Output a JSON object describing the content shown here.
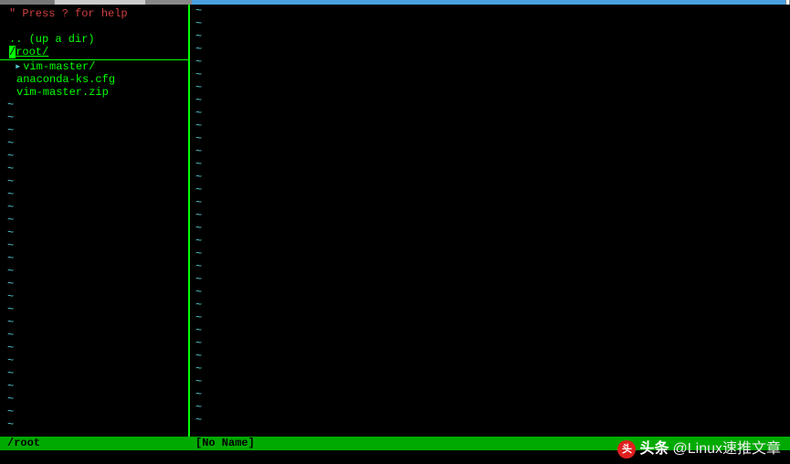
{
  "nerdtree": {
    "help_quote": "\"",
    "help_text": " Press ? for help",
    "updir": ".. (up a dir)",
    "root_first": "/",
    "root_rest": "root/",
    "items": [
      {
        "arrow": "▸",
        "name": "vim-master/",
        "type": "dir"
      },
      {
        "arrow": " ",
        "name": "anaconda-ks.cfg",
        "type": "file"
      },
      {
        "arrow": " ",
        "name": "vim-master.zip",
        "type": "file"
      }
    ],
    "tilde": "~"
  },
  "editor": {
    "tilde": "~"
  },
  "statusbar": {
    "left": "/root",
    "right": "[No Name]"
  },
  "watermark": {
    "logo": "头条",
    "brand": "头条",
    "handle": "@Linux速推文章"
  }
}
